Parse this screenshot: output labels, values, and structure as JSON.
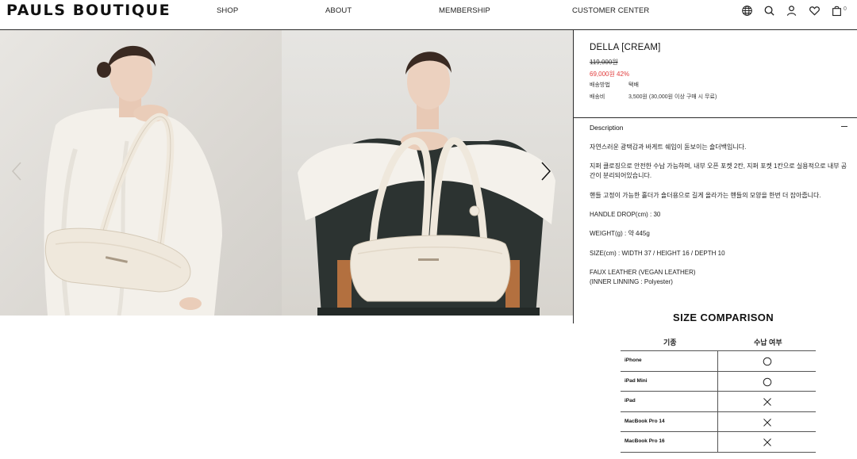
{
  "header": {
    "logo": "PAULS BOUTIQUE",
    "nav": [
      "SHOP",
      "ABOUT",
      "MEMBERSHIP",
      "CUSTOMER CENTER"
    ],
    "icons": [
      "globe-icon",
      "search-icon",
      "user-icon",
      "heart-icon",
      "bag-icon"
    ],
    "cart_count": "0"
  },
  "product": {
    "name": "DELLA [CREAM]",
    "original_price": "119,000원",
    "sale_price": "69,000원 42%",
    "info": [
      {
        "label": "배송방법",
        "value": "택배"
      },
      {
        "label": "배송비",
        "value": "3,500원 (30,000원 이상 구매 시 무료)"
      }
    ]
  },
  "description": {
    "title": "Description",
    "lines": [
      "자연스러운 광택감과 바게트 쉐입이 돋보이는 숄더백입니다.",
      "지퍼 클로징으로 안전한 수납 가능하며, 내부 오픈 포켓 2칸, 지퍼 포켓 1칸으로 실용적으로 내부 공간이 분리되어있습니다.",
      "핸들 고정이 가능한 홀더가 숄더용으로 길게 올라가는 핸들의 모양을 한번 더 잡아줍니다.",
      "HANDLE DROP(cm) : 30",
      "WEIGHT(g) : 약 445g",
      "SIZE(cm) :  WIDTH 37 / HEIGHT 16 / DEPTH 10",
      "FAUX LEATHER (VEGAN LEATHER)",
      "(INNER LINNING : Polyester)"
    ]
  },
  "size_comparison": {
    "title": "SIZE COMPARISON",
    "headers": [
      "기종",
      "수납 여부"
    ],
    "rows": [
      {
        "device": "iPhone",
        "fits": true
      },
      {
        "device": "iPad Mini",
        "fits": true
      },
      {
        "device": "iPad",
        "fits": false
      },
      {
        "device": "MacBook Pro 14",
        "fits": false
      },
      {
        "device": "MacBook Pro 16",
        "fits": false
      }
    ]
  },
  "colors": {
    "sale": "#e03b3b",
    "border": "#2b2b2b",
    "bag_cream": "#efe8dc"
  }
}
